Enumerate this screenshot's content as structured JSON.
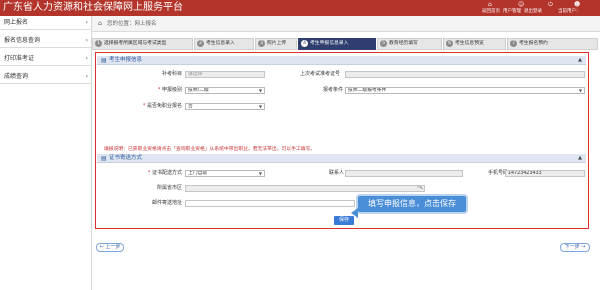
{
  "header": {
    "title": "广东省人力资源和社会保障网上服务平台",
    "links": [
      "返回首页",
      "用户管理",
      "退出登录"
    ],
    "current_user": "当前用户："
  },
  "sidebar": {
    "items": [
      {
        "label": "网上报名"
      },
      {
        "label": "报名信息查询"
      },
      {
        "label": "打印准考证"
      },
      {
        "label": "成绩查询"
      }
    ]
  },
  "breadcrumb": {
    "text": "您的位置：网上报名"
  },
  "steps": [
    {
      "num": "1",
      "label": "选择报考所属区域与考试类型"
    },
    {
      "num": "2",
      "label": "考生信息录入"
    },
    {
      "num": "3",
      "label": "照片上传"
    },
    {
      "num": "4",
      "label": "考生申报信息录入"
    },
    {
      "num": "5",
      "label": "教育经历填写"
    },
    {
      "num": "6",
      "label": "考生信息预览"
    },
    {
      "num": "7",
      "label": "考生报名预约"
    }
  ],
  "section1": {
    "title": "考生申报信息",
    "collapse": "▲",
    "fields": {
      "bukao_label": "补考科目",
      "bukao_placeholder": "请选择",
      "prev_exam_label": "上次考试准考证号",
      "apply_level_label": "申报级别",
      "apply_level_value": "技师/二级",
      "condition_label": "报考条件",
      "condition_value": "技师二级报考条件",
      "recognized_label": "是否免职业报名",
      "recognized_value": "否"
    },
    "note": "填报说明：已获职业资格请点击「查询职业资格」从系统中带出职业，若无法带出，可以手工填写。"
  },
  "section2": {
    "title": "证书寄送方式",
    "collapse": "▲",
    "fields": {
      "method_label": "证书配送方式",
      "method_value": "上门自取",
      "contact_label": "联系人",
      "phone_label": "手机号码",
      "phone_value": "14723423433",
      "region_label": "所属省市区",
      "postal_label": "邮件寄送地址"
    }
  },
  "save_label": "保存",
  "callout_text": "填写申报信息，点击保存",
  "nav": {
    "prev": "← 上一步",
    "next": "下一步 →"
  }
}
